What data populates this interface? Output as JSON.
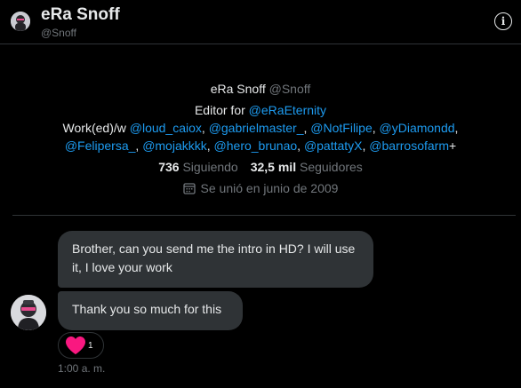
{
  "header": {
    "name": "eRa Snoff",
    "handle": "@Snoff",
    "info_icon": "info-icon"
  },
  "profile": {
    "name": "eRa Snoff",
    "handle": "@Snoff",
    "bio_line1_prefix": "Editor for ",
    "bio_line1_link": "@eRaEternity",
    "bio_line2_prefix": "Work(ed)/w ",
    "bio_line2_links": [
      "@loud_caiox",
      "@gabrielmaster_",
      "@NotFilipe",
      "@yDiamondd"
    ],
    "bio_line3_links": [
      "@Felipersa_",
      "@mojakkkk",
      "@hero_brunao",
      "@pattatyX",
      "@barrosofarm"
    ],
    "bio_line3_suffix": "+",
    "following_count": "736",
    "following_label": "Siguiendo",
    "followers_count": "32,5 mil",
    "followers_label": "Seguidores",
    "joined": "Se unió en junio de 2009"
  },
  "messages": [
    {
      "text": "Brother, can you send me the intro in HD? I will use it, I love your work"
    },
    {
      "text": "Thank you so much for this"
    }
  ],
  "reaction": {
    "icon": "heart-icon",
    "count": "1"
  },
  "timestamp": "1:00 a. m.",
  "colors": {
    "background": "#000000",
    "bubble": "#2f3336",
    "link": "#1d9bf0",
    "muted": "#71767b",
    "heart": "#f91880"
  }
}
